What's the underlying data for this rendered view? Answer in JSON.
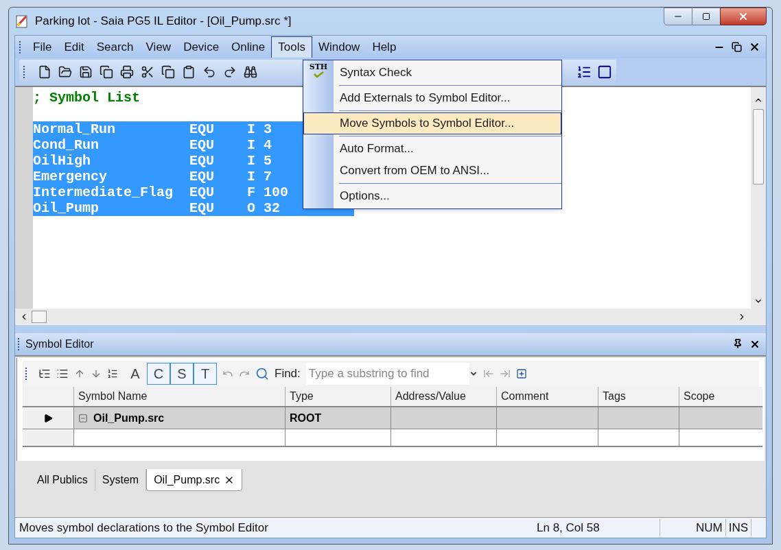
{
  "window": {
    "title": "Parking lot - Saia PG5 IL Editor - [Oil_Pump.src *]"
  },
  "menu_bar": [
    {
      "label": "File",
      "selected": false
    },
    {
      "label": "Edit",
      "selected": false
    },
    {
      "label": "Search",
      "selected": false
    },
    {
      "label": "View",
      "selected": false
    },
    {
      "label": "Device",
      "selected": false
    },
    {
      "label": "Online",
      "selected": false
    },
    {
      "label": "Tools",
      "selected": true
    },
    {
      "label": "Window",
      "selected": false
    },
    {
      "label": "Help",
      "selected": false
    }
  ],
  "tools_menu": [
    {
      "label": "Syntax Check",
      "icon_text": "STH",
      "selected": false,
      "separator_after": true
    },
    {
      "label": "Add Externals to Symbol Editor...",
      "selected": false,
      "separator_after": true
    },
    {
      "label": "Move Symbols to Symbol Editor...",
      "selected": true,
      "separator_after": true
    },
    {
      "label": "Auto Format...",
      "selected": false,
      "separator_after": false
    },
    {
      "label": "Convert from OEM to ANSI...",
      "selected": false,
      "separator_after": true
    },
    {
      "label": "Options...",
      "selected": false,
      "separator_after": false
    }
  ],
  "editor": {
    "lines": [
      {
        "kind": "comment",
        "text": "; Symbol List"
      },
      {
        "kind": "blank"
      },
      {
        "kind": "code",
        "name": "Normal_Run",
        "op": "EQU",
        "operand": "I 3",
        "selected": true
      },
      {
        "kind": "code",
        "name": "Cond_Run",
        "op": "EQU",
        "operand": "I 4",
        "selected": true
      },
      {
        "kind": "code",
        "name": "OilHigh",
        "op": "EQU",
        "operand": "I 5",
        "selected": true
      },
      {
        "kind": "code",
        "name": "Emergency",
        "op": "EQU",
        "operand": "I 7",
        "selected": true
      },
      {
        "kind": "code",
        "name": "Intermediate_Flag",
        "op": "EQU",
        "operand": "F 100",
        "selected": true
      },
      {
        "kind": "code",
        "name": "Oil_Pump",
        "op": "EQU",
        "operand": "O 32",
        "selected": true
      }
    ]
  },
  "symbol_editor": {
    "title": "Symbol Editor",
    "toggles": [
      {
        "label": "A",
        "selected": false
      },
      {
        "label": "C",
        "selected": true
      },
      {
        "label": "S",
        "selected": true
      },
      {
        "label": "T",
        "selected": true
      }
    ],
    "find_label": "Find:",
    "find_placeholder": "Type a substring to find",
    "columns": [
      "Symbol Name",
      "Type",
      "Address/Value",
      "Comment",
      "Tags",
      "Scope"
    ],
    "rows": [
      {
        "symbol_name": "Oil_Pump.src",
        "type": "ROOT",
        "current": true,
        "expanded": true
      }
    ],
    "tabs": [
      {
        "label": "All Publics",
        "selected": false,
        "closable": false
      },
      {
        "label": "System",
        "selected": false,
        "closable": false
      },
      {
        "label": "Oil_Pump.src",
        "selected": true,
        "closable": true
      }
    ]
  },
  "status_bar": {
    "message": "Moves symbol declarations to the Symbol Editor",
    "position": "Ln 8, Col 58",
    "indicators": [
      "NUM",
      "INS"
    ]
  }
}
